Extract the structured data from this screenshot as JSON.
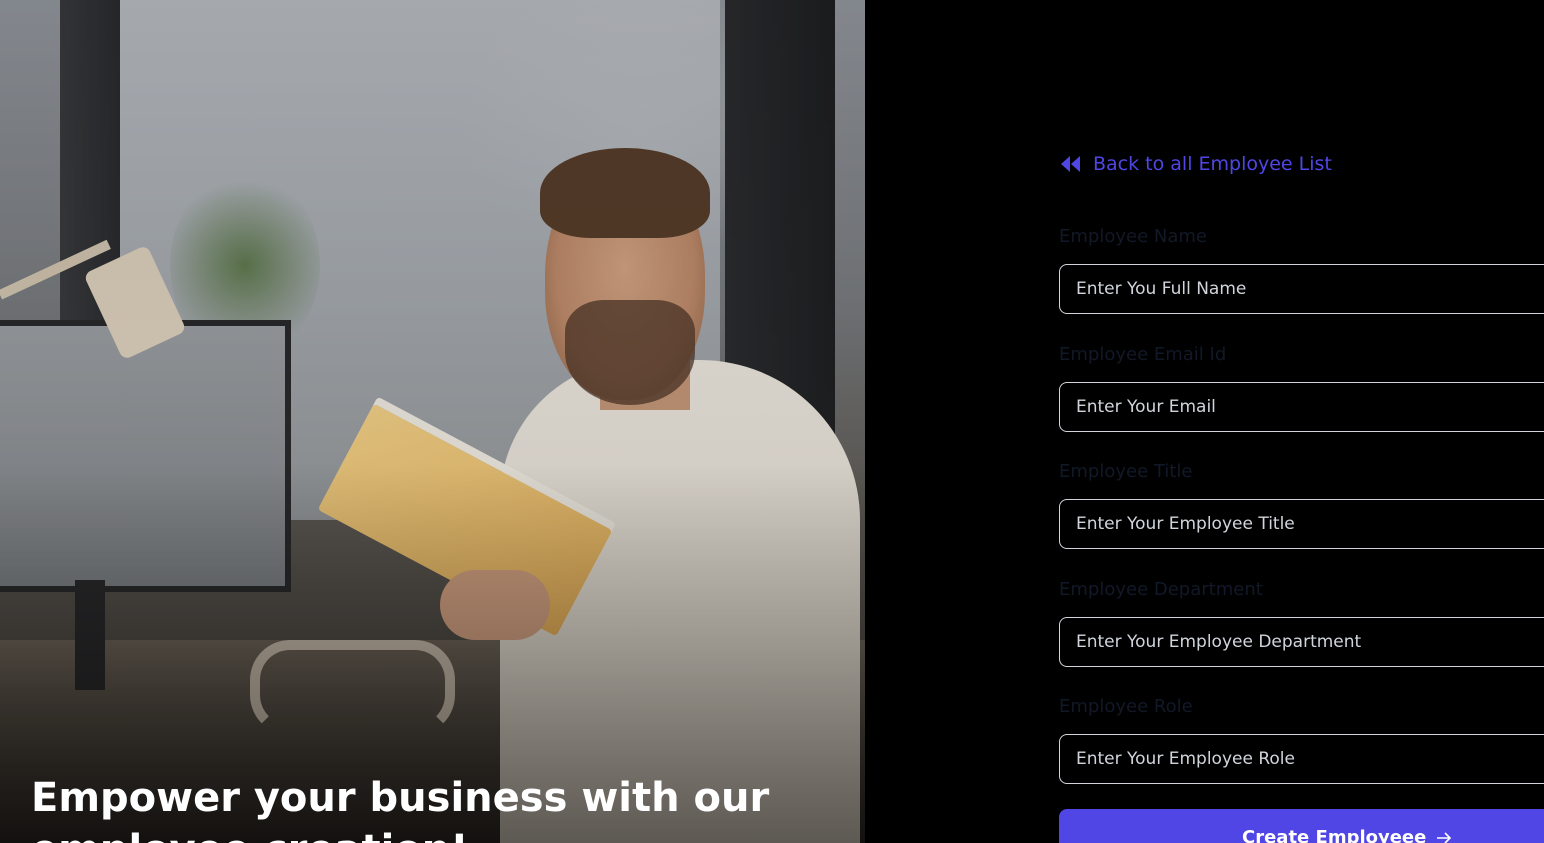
{
  "hero": {
    "headline": "Empower your business with our employee creation!"
  },
  "form": {
    "back_link": {
      "label": "Back to all Employee List",
      "icon": "double-chevron-left-icon"
    },
    "fields": [
      {
        "label": "Employee Name",
        "placeholder": "Enter You Full Name"
      },
      {
        "label": "Employee Email Id",
        "placeholder": "Enter Your Email"
      },
      {
        "label": "Employee Title",
        "placeholder": "Enter Your Employee Title"
      },
      {
        "label": "Employee Department",
        "placeholder": "Enter Your Employee Department"
      },
      {
        "label": "Employee Role",
        "placeholder": "Enter Your Employee Role"
      }
    ],
    "submit": {
      "label": "Create Employeee",
      "icon": "arrow-right-icon"
    }
  },
  "colors": {
    "accent": "#4f46e5",
    "background": "#000000",
    "label_text": "#111827",
    "input_border": "#d1d5db"
  }
}
